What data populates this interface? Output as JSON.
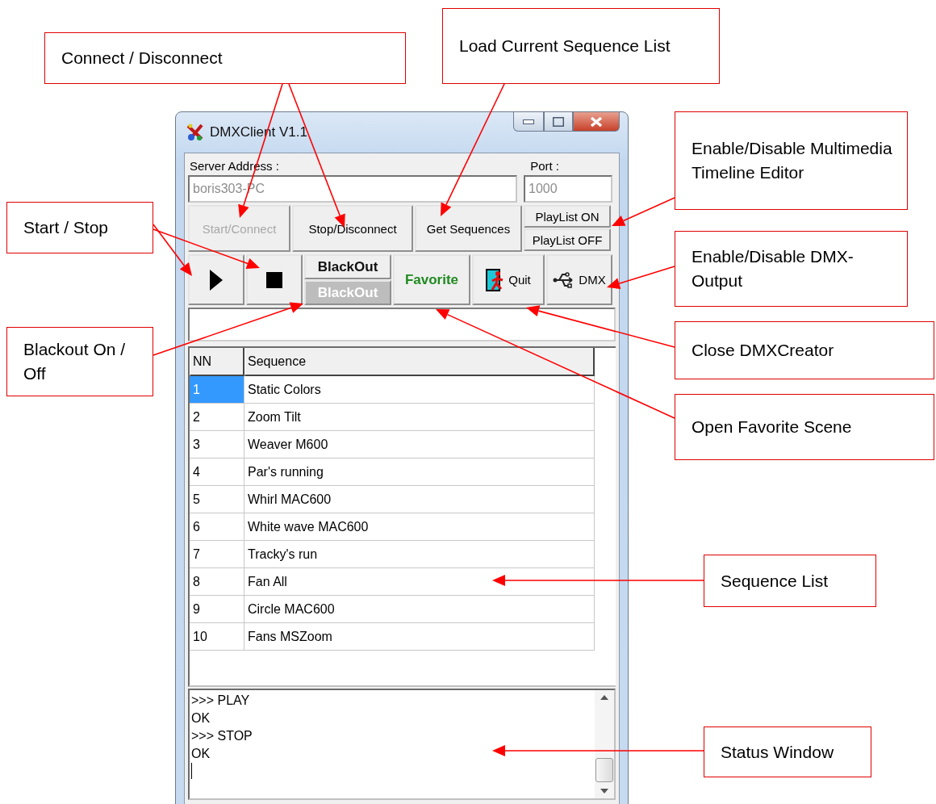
{
  "callouts": [
    {
      "text": "Connect / Disconnect"
    },
    {
      "text": "Load Current Sequence List"
    },
    {
      "text": "Start / Stop"
    },
    {
      "text": "Enable/Disable Multimedia Timeline Editor"
    },
    {
      "text": "Enable/Disable DMX-Output"
    },
    {
      "text": "Blackout On / Off"
    },
    {
      "text": "Close DMXCreator"
    },
    {
      "text": "Open Favorite Scene"
    },
    {
      "text": "Sequence List"
    },
    {
      "text": "Status Window"
    }
  ],
  "window": {
    "title": "DMXClient V1.1"
  },
  "server": {
    "label": "Server Address :",
    "value": "boris303-PC"
  },
  "port": {
    "label": "Port :",
    "value": "1000"
  },
  "connect_buttons": [
    {
      "label": "Start/Connect",
      "disabled": true
    },
    {
      "label": "Stop/Disconnect",
      "disabled": false
    },
    {
      "label": "Get Sequences",
      "disabled": false
    }
  ],
  "playlist_buttons": [
    {
      "label": "PlayList ON"
    },
    {
      "label": "PlayList OFF"
    }
  ],
  "blackout_buttons": [
    {
      "label": "BlackOut",
      "disabled": false
    },
    {
      "label": "BlackOut",
      "disabled": true
    }
  ],
  "favorite_button": {
    "label": "Favorite"
  },
  "quit_button": {
    "label": "Quit"
  },
  "dmx_button": {
    "label": "DMX"
  },
  "table": {
    "columns": [
      "NN",
      "Sequence"
    ],
    "rows": [
      {
        "nn": "1",
        "sequence": "Static Colors",
        "selected": true
      },
      {
        "nn": "2",
        "sequence": "Zoom Tilt",
        "selected": false
      },
      {
        "nn": "3",
        "sequence": "Weaver M600",
        "selected": false
      },
      {
        "nn": "4",
        "sequence": "Par's running",
        "selected": false
      },
      {
        "nn": "5",
        "sequence": "Whirl MAC600",
        "selected": false
      },
      {
        "nn": "6",
        "sequence": "White wave MAC600",
        "selected": false
      },
      {
        "nn": "7",
        "sequence": "Tracky's run",
        "selected": false
      },
      {
        "nn": "8",
        "sequence": "Fan All",
        "selected": false
      },
      {
        "nn": "9",
        "sequence": "Circle MAC600",
        "selected": false
      },
      {
        "nn": "10",
        "sequence": "Fans MSZoom",
        "selected": false
      }
    ]
  },
  "status_lines": [
    ">>> PLAY",
    "OK",
    ">>> STOP",
    "OK"
  ]
}
